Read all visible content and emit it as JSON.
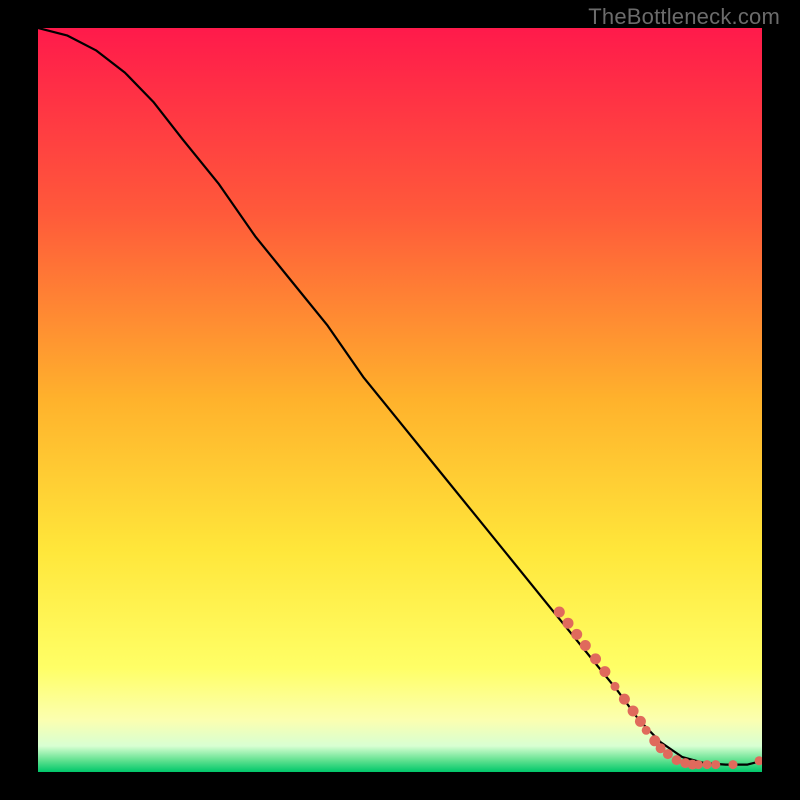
{
  "attribution": "TheBottleneck.com",
  "chart_data": {
    "type": "line",
    "title": "",
    "xlabel": "",
    "ylabel": "",
    "xlim": [
      0,
      100
    ],
    "ylim": [
      0,
      100
    ],
    "grid": false,
    "legend": false,
    "background": {
      "kind": "vertical-gradient",
      "stops": [
        {
          "pos": 0.0,
          "color": "#ff1a4b"
        },
        {
          "pos": 0.25,
          "color": "#ff5a3a"
        },
        {
          "pos": 0.5,
          "color": "#ffb22c"
        },
        {
          "pos": 0.7,
          "color": "#ffe63a"
        },
        {
          "pos": 0.86,
          "color": "#ffff66"
        },
        {
          "pos": 0.93,
          "color": "#fbffb0"
        },
        {
          "pos": 0.965,
          "color": "#d8ffd2"
        },
        {
          "pos": 0.985,
          "color": "#5de08e"
        },
        {
          "pos": 1.0,
          "color": "#00c76a"
        }
      ]
    },
    "series": [
      {
        "name": "bottleneck-curve",
        "x": [
          0,
          4,
          8,
          12,
          16,
          20,
          25,
          30,
          35,
          40,
          45,
          50,
          55,
          60,
          65,
          70,
          75,
          80,
          83,
          86,
          89,
          92,
          95,
          98,
          100
        ],
        "y": [
          100,
          99,
          97,
          94,
          90,
          85,
          79,
          72,
          66,
          60,
          53,
          47,
          41,
          35,
          29,
          23,
          17,
          11,
          7,
          4,
          2,
          1.2,
          1.0,
          1.0,
          1.5
        ],
        "stroke": "#000000",
        "stroke_width": 2.2
      }
    ],
    "markers": [
      {
        "x": 72.0,
        "y": 21.5,
        "r": 5.5,
        "color": "#e06a5c"
      },
      {
        "x": 73.2,
        "y": 20.0,
        "r": 5.5,
        "color": "#e06a5c"
      },
      {
        "x": 74.4,
        "y": 18.5,
        "r": 5.5,
        "color": "#e06a5c"
      },
      {
        "x": 75.6,
        "y": 17.0,
        "r": 5.5,
        "color": "#e06a5c"
      },
      {
        "x": 77.0,
        "y": 15.2,
        "r": 5.5,
        "color": "#e06a5c"
      },
      {
        "x": 78.3,
        "y": 13.5,
        "r": 5.5,
        "color": "#e06a5c"
      },
      {
        "x": 79.7,
        "y": 11.5,
        "r": 4.5,
        "color": "#e06a5c"
      },
      {
        "x": 81.0,
        "y": 9.8,
        "r": 5.5,
        "color": "#e06a5c"
      },
      {
        "x": 82.2,
        "y": 8.2,
        "r": 5.5,
        "color": "#e06a5c"
      },
      {
        "x": 83.2,
        "y": 6.8,
        "r": 5.5,
        "color": "#e06a5c"
      },
      {
        "x": 84.0,
        "y": 5.6,
        "r": 4.5,
        "color": "#e06a5c"
      },
      {
        "x": 85.2,
        "y": 4.2,
        "r": 5.5,
        "color": "#e06a5c"
      },
      {
        "x": 86.0,
        "y": 3.2,
        "r": 5.0,
        "color": "#e06a5c"
      },
      {
        "x": 87.0,
        "y": 2.4,
        "r": 5.0,
        "color": "#e06a5c"
      },
      {
        "x": 88.2,
        "y": 1.6,
        "r": 5.0,
        "color": "#e06a5c"
      },
      {
        "x": 89.4,
        "y": 1.2,
        "r": 5.0,
        "color": "#e06a5c"
      },
      {
        "x": 90.4,
        "y": 1.0,
        "r": 5.0,
        "color": "#e06a5c"
      },
      {
        "x": 91.2,
        "y": 1.0,
        "r": 4.5,
        "color": "#e06a5c"
      },
      {
        "x": 92.4,
        "y": 1.0,
        "r": 4.5,
        "color": "#e06a5c"
      },
      {
        "x": 93.6,
        "y": 1.0,
        "r": 4.5,
        "color": "#e06a5c"
      },
      {
        "x": 96.0,
        "y": 1.0,
        "r": 4.5,
        "color": "#e06a5c"
      },
      {
        "x": 99.6,
        "y": 1.5,
        "r": 4.5,
        "color": "#e06a5c"
      }
    ]
  }
}
